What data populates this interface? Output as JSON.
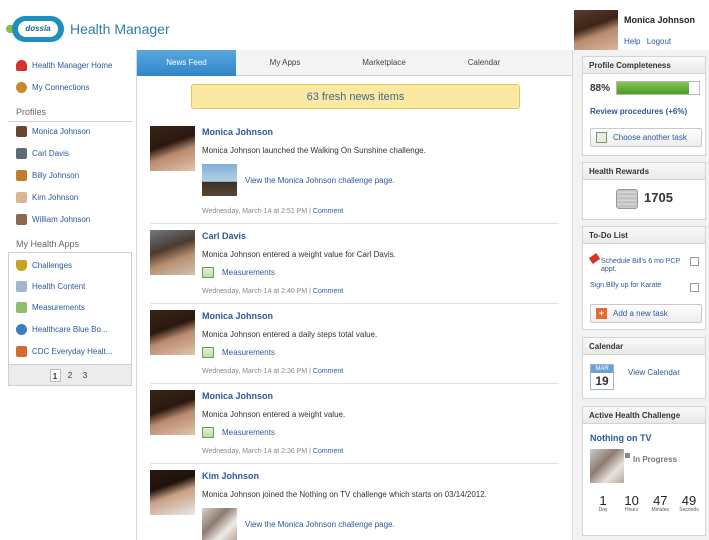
{
  "header": {
    "logo_text": "dossia",
    "app_title": "Health Manager"
  },
  "user": {
    "name": "Monica Johnson",
    "help": "Help",
    "logout": "Logout"
  },
  "leftnav": {
    "top_items": [
      {
        "label": "Health Manager Home",
        "color": "#d9322a"
      },
      {
        "label": "My Connections",
        "color": "#c78a2b"
      }
    ],
    "profiles_heading": "Profiles",
    "profiles": [
      {
        "label": "Monica Johnson",
        "color": "#6a4632"
      },
      {
        "label": "Carl Davis",
        "color": "#5f6b74"
      },
      {
        "label": "Billy Johnson",
        "color": "#c27d2c"
      },
      {
        "label": "Kim Johnson",
        "color": "#d8b696"
      },
      {
        "label": "William Johnson",
        "color": "#8a6a4a"
      }
    ],
    "apps_heading": "My Health Apps",
    "apps": [
      {
        "label": "Challenges",
        "color": "#c9a320"
      },
      {
        "label": "Health Content",
        "color": "#9fb9c9"
      },
      {
        "label": "Measurements",
        "color": "#8fbf6a"
      },
      {
        "label": "Healthcare Blue Bo...",
        "color": "#3c7fc0"
      },
      {
        "label": "CDC Everyday Healt...",
        "color": "#d36a2b"
      }
    ],
    "pages": [
      "1",
      "2",
      "3"
    ],
    "active_page": "1"
  },
  "tabs": [
    "News Feed",
    "My Apps",
    "Marketplace",
    "Calendar"
  ],
  "active_tab": "News Feed",
  "banner": "63 fresh news items",
  "feed": [
    {
      "name": "Monica Johnson",
      "text": "Monica Johnson launched the Walking On Sunshine challenge.",
      "link": "View the Monica Johnson challenge page.",
      "link_type": "challenge",
      "meta": "Wednesday, March 14 at 2:51 PM |",
      "comment": "Comment"
    },
    {
      "name": "Carl Davis",
      "text": "Monica Johnson entered a weight value for Carl Davis.",
      "link": "Measurements",
      "link_type": "measure",
      "meta": "Wednesday, March 14 at 2:40 PM |",
      "comment": "Comment"
    },
    {
      "name": "Monica Johnson",
      "text": "Monica Johnson entered a daily steps total value.",
      "link": "Measurements",
      "link_type": "measure",
      "meta": "Wednesday, March 14 at 2:36 PM |",
      "comment": "Comment"
    },
    {
      "name": "Monica Johnson",
      "text": "Monica Johnson entered a weight value.",
      "link": "Measurements",
      "link_type": "measure",
      "meta": "Wednesday, March 14 at 2:36 PM |",
      "comment": "Comment"
    },
    {
      "name": "Kim Johnson",
      "text": "Monica Johnson joined the Nothing on TV challenge which starts on 03/14/2012.",
      "link": "View the Monica Johnson challenge page.",
      "link_type": "challenge2",
      "meta": "",
      "comment": ""
    }
  ],
  "right": {
    "profile": {
      "heading": "Profile Completeness",
      "percent": "88%",
      "progress": 0.88,
      "review": "Review procedures (+6%)",
      "button": "Choose another task"
    },
    "rewards": {
      "heading": "Health Rewards",
      "points": "1705"
    },
    "todo": {
      "heading": "To-Do List",
      "items": [
        "Schedule Bill's 6 mo PCP appt.",
        "Sign Billy up for Karate"
      ],
      "button": "Add a new task"
    },
    "calendar": {
      "heading": "Calendar",
      "month": "MAR",
      "day": "19",
      "link": "View Calendar"
    },
    "challenge": {
      "heading": "Active Health Challenge",
      "title": "Nothing on TV",
      "status": "In Progress",
      "countdown": [
        {
          "num": "1",
          "label": "Day"
        },
        {
          "num": "10",
          "label": "Hours"
        },
        {
          "num": "47",
          "label": "Minutes"
        },
        {
          "num": "49",
          "label": "Seconds"
        }
      ]
    }
  },
  "colors": {
    "accent": "#2a5a9a",
    "banner_bg": "#fbe9a1",
    "progress": "#5aa62e",
    "tab_active": "#3b8fd0"
  }
}
